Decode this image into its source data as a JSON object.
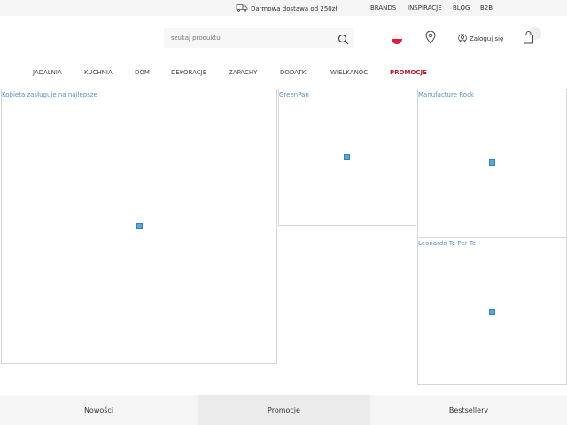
{
  "topbar": {
    "promo_text": "Darmowa dostawa od 250zł",
    "links": [
      "BRANDS",
      "INSPIRACJE",
      "BLOG",
      "B2B"
    ]
  },
  "header": {
    "search_placeholder": "szukaj produktu",
    "login_label": "Zaloguj się"
  },
  "nav": {
    "items": [
      "JADALNIA",
      "KUCHNIA",
      "DOM",
      "DEKORACJE",
      "ZAPACHY",
      "DODATKI",
      "WIELKANOC",
      "PROMOCJE"
    ]
  },
  "banners": [
    {
      "alt": "Kobieta zasługuje na najlepsze"
    },
    {
      "alt": "GreenPan"
    },
    {
      "alt": "Manufacture Rock"
    },
    {
      "alt": "Leonardo Te Per Te"
    }
  ],
  "bottom_tabs": [
    "Nowości",
    "Promocje",
    "Bestsellery"
  ],
  "colors": {
    "accent_red": "#b0202a",
    "link_blue": "#5a8fbf",
    "topbar_bg": "#f5f5f5"
  }
}
